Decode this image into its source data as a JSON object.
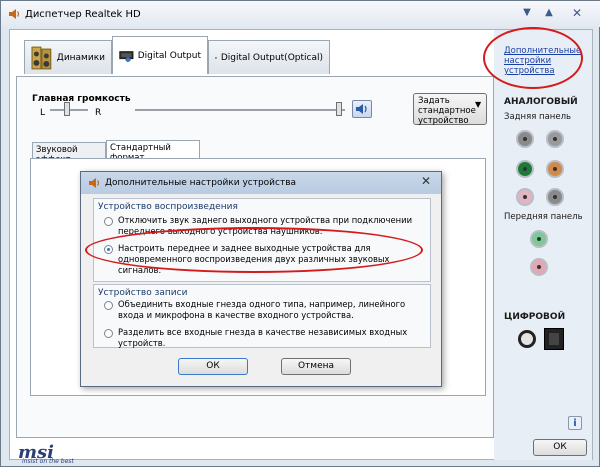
{
  "window": {
    "title": "Диспетчер Realtek HD",
    "controls": [
      "▼",
      "▲",
      "✕"
    ]
  },
  "tabs": [
    {
      "label": "Динамики"
    },
    {
      "label": "Digital Output"
    },
    {
      "label": "Digital Output(Optical)"
    }
  ],
  "volume": {
    "label": "Главная громкость",
    "left": "L",
    "right": "R"
  },
  "default_device_button": "Задать стандартное устройство",
  "subtabs": [
    {
      "label": "Звуковой эффект"
    },
    {
      "label": "Стандартный формат"
    }
  ],
  "right_panel": {
    "link": "Дополнительные настройки устройства",
    "analog": "АНАЛОГОВЫЙ",
    "rear_panel": "Задняя панель",
    "front_panel": "Передняя панель",
    "digital": "ЦИФРОВОЙ"
  },
  "dialog": {
    "title": "Дополнительные настройки устройства",
    "playback_group": "Устройство воспроизведения",
    "playback_opt1": "Отключить звук заднего выходного устройства при подключении переднего выходного устройства наушников.",
    "playback_opt2": "Настроить переднее и заднее выходные устройства для одновременного воспроизведения двух различных звуковых сигналов.",
    "record_group": "Устройство записи",
    "record_opt1": "Объединить входные гнезда одного типа, например, линейного входа и микрофона в качестве входного устройства.",
    "record_opt2": "Разделить все входные гнезда в качестве независимых входных устройств.",
    "ok": "ОК",
    "cancel": "Отмена"
  },
  "footer": {
    "logo": "msi",
    "tagline": "insist on the best",
    "ok": "ОК"
  },
  "colors": {
    "jack_rear": [
      "#888888",
      "#8a8a8a",
      "#1f7a3a",
      "#d08a4a",
      "#d8a8b8",
      "#8a8a8a"
    ],
    "jack_front": [
      "#6fbf8a",
      "#d8a0ac"
    ],
    "annotation": "#d41b1b"
  }
}
